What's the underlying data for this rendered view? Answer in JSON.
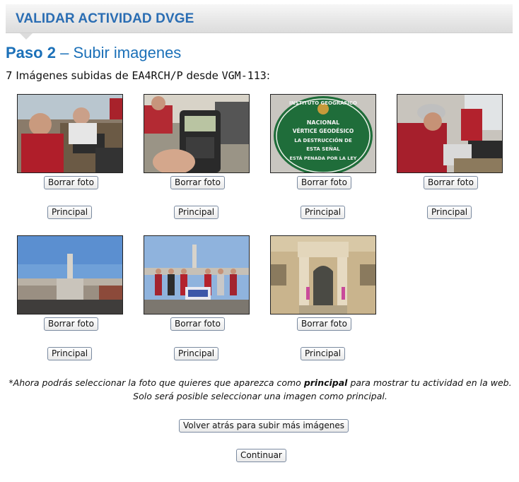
{
  "header": {
    "title": "VALIDAR ACTIVIDAD DVGE"
  },
  "step": {
    "number": "Paso 2",
    "separator": "–",
    "title": "Subir imagenes"
  },
  "summary": {
    "count": "7",
    "text_1": "Imágenes subidas de",
    "callsign": "EA4RCH/P",
    "text_2": "desde",
    "reference": "VGM-113",
    "text_3": ":"
  },
  "photos": [
    {
      "icon": "photo-operators-radio-table",
      "delete_label": "Borrar foto",
      "main_label": "Principal"
    },
    {
      "icon": "photo-handheld-radio-kenwood",
      "delete_label": "Borrar foto",
      "main_label": "Principal"
    },
    {
      "icon": "photo-geodesic-vertex-plaque",
      "delete_label": "Borrar foto",
      "main_label": "Principal"
    },
    {
      "icon": "photo-operator-cap-radio",
      "delete_label": "Borrar foto",
      "main_label": "Principal"
    },
    {
      "icon": "photo-rooftop-vertex-pillar",
      "delete_label": "Borrar foto",
      "main_label": "Principal"
    },
    {
      "icon": "photo-group-banner-rooftop",
      "delete_label": "Borrar foto",
      "main_label": "Principal"
    },
    {
      "icon": "photo-instituto-building-entrance",
      "delete_label": "Borrar foto",
      "main_label": "Principal"
    }
  ],
  "plaque_text": {
    "line1": "INSTITUTO GEOGRÁFICO",
    "line2": "NACIONAL",
    "line3": "VÉRTICE GEODÉSICO",
    "line4": "LA DESTRUCCIÓN DE",
    "line5": "ESTA SEÑAL",
    "line6": "ESTÁ PENADA POR LA LEY"
  },
  "note": {
    "prefix": "*Ahora podrás seleccionar la foto que quieres que aparezca como ",
    "bold": "principal",
    "suffix": " para mostrar tu actividad en la web. Solo será posible seleccionar una imagen como principal."
  },
  "actions": {
    "back_label": "Volver atrás para subir más imágenes",
    "continue_label": "Continuar"
  },
  "colors": {
    "accent": "#2a6db3",
    "heading": "#1b70b8"
  }
}
